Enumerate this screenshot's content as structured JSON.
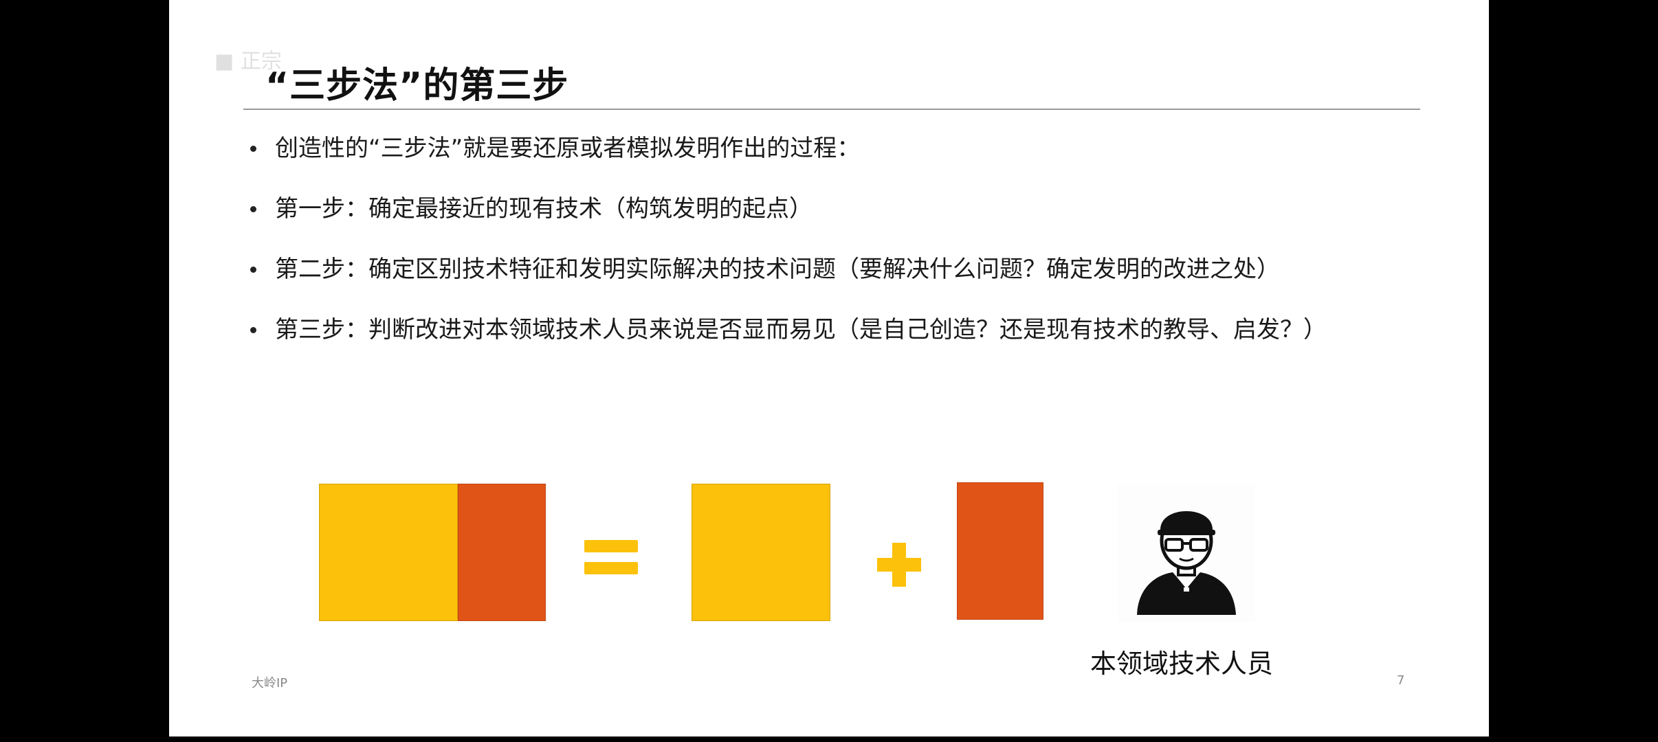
{
  "slide": {
    "title": "“三步法”的第三步",
    "bullets": [
      "创造性的“三步法”就是要还原或者模拟发明作出的过程：",
      "第一步：确定最接近的现有技术（构筑发明的起点）",
      "第二步：确定区别技术特征和发明实际解决的技术问题（要解决什么问题？确定发明的改进之处）",
      "第三步：判断改进对本领域技术人员来说是否显而易见（是自己创造？还是现有技术的教导、启发？）"
    ],
    "person_label": "本领域技术人员",
    "footer_brand": "大岭IP",
    "page_number": "7",
    "watermark": "■ 正宗"
  },
  "colors": {
    "yellow": "#fcc10a",
    "orange": "#e15417"
  },
  "icons": {
    "person": "person-with-cap-and-glasses-icon",
    "equals": "equals-icon",
    "plus": "plus-icon"
  }
}
